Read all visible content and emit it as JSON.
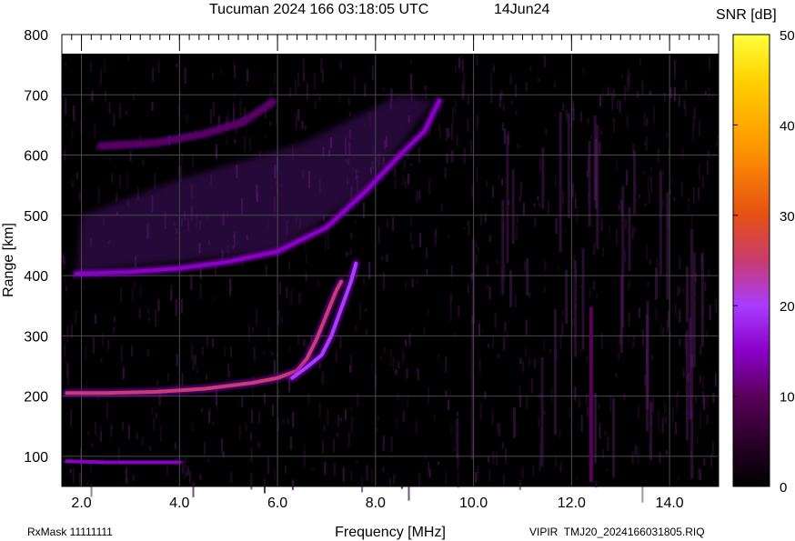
{
  "chart_data": {
    "type": "heatmap",
    "title": "Tucuman 2024 166 03:18:05 UTC",
    "date_label": "14Jun24",
    "xlabel": "Frequency [MHz]",
    "ylabel": "Range [km]",
    "colorbar_label": "SNR [dB]",
    "xlim": [
      1.6,
      15.0
    ],
    "ylim": [
      50,
      800
    ],
    "x_ticks": [
      "2.0",
      "4.0",
      "6.0",
      "8.0",
      "10.0",
      "12.0",
      "14.0"
    ],
    "y_ticks": [
      "100",
      "200",
      "300",
      "400",
      "500",
      "600",
      "700",
      "800"
    ],
    "colorbar_ticks": [
      "0",
      "10",
      "20",
      "30",
      "40",
      "50"
    ],
    "colorbar_range": [
      0,
      50
    ],
    "grid": true,
    "colors": {
      "background": "#000000",
      "grid": "#4a4a4a",
      "colormap": [
        "#000000",
        "#2a0028",
        "#5a005a",
        "#8a00c8",
        "#a83cff",
        "#c83c6e",
        "#e65014",
        "#ff9600",
        "#ffd200",
        "#ffff3c"
      ]
    },
    "traces": [
      {
        "name": "E-layer O-mode",
        "points": [
          [
            1.7,
            205
          ],
          [
            2.5,
            205
          ],
          [
            3.5,
            207
          ],
          [
            4.5,
            212
          ],
          [
            5.5,
            222
          ],
          [
            6.0,
            230
          ],
          [
            6.4,
            242
          ],
          [
            6.6,
            262
          ],
          [
            6.8,
            295
          ],
          [
            7.0,
            335
          ],
          [
            7.2,
            375
          ],
          [
            7.3,
            390
          ]
        ],
        "snr": 30
      },
      {
        "name": "E-layer X-mode",
        "points": [
          [
            6.3,
            230
          ],
          [
            6.6,
            248
          ],
          [
            6.9,
            268
          ],
          [
            7.1,
            300
          ],
          [
            7.3,
            345
          ],
          [
            7.5,
            390
          ],
          [
            7.6,
            420
          ]
        ],
        "snr": 22
      },
      {
        "name": "F-layer",
        "points": [
          [
            1.9,
            403
          ],
          [
            3.0,
            406
          ],
          [
            4.0,
            412
          ],
          [
            5.0,
            423
          ],
          [
            6.0,
            440
          ],
          [
            7.0,
            480
          ],
          [
            7.8,
            540
          ],
          [
            8.5,
            600
          ],
          [
            9.0,
            640
          ],
          [
            9.3,
            690
          ]
        ],
        "snr": 18
      },
      {
        "name": "F-layer 2nd hop",
        "points": [
          [
            2.4,
            615
          ],
          [
            3.5,
            620
          ],
          [
            4.5,
            635
          ],
          [
            5.3,
            655
          ],
          [
            5.9,
            688
          ]
        ],
        "snr": 12
      },
      {
        "name": "Low range echo",
        "points": [
          [
            1.7,
            92
          ],
          [
            2.5,
            90
          ],
          [
            3.5,
            90
          ],
          [
            4.0,
            90
          ]
        ],
        "snr": 14
      },
      {
        "name": "Interference 12.4 MHz",
        "points": [
          [
            12.4,
            60
          ],
          [
            12.4,
            345
          ]
        ],
        "snr": 12
      }
    ]
  },
  "footer": {
    "rx_mask": "RxMask 11111111",
    "file_info": "VIPIR  TMJ20_2024166031805.RIQ"
  }
}
